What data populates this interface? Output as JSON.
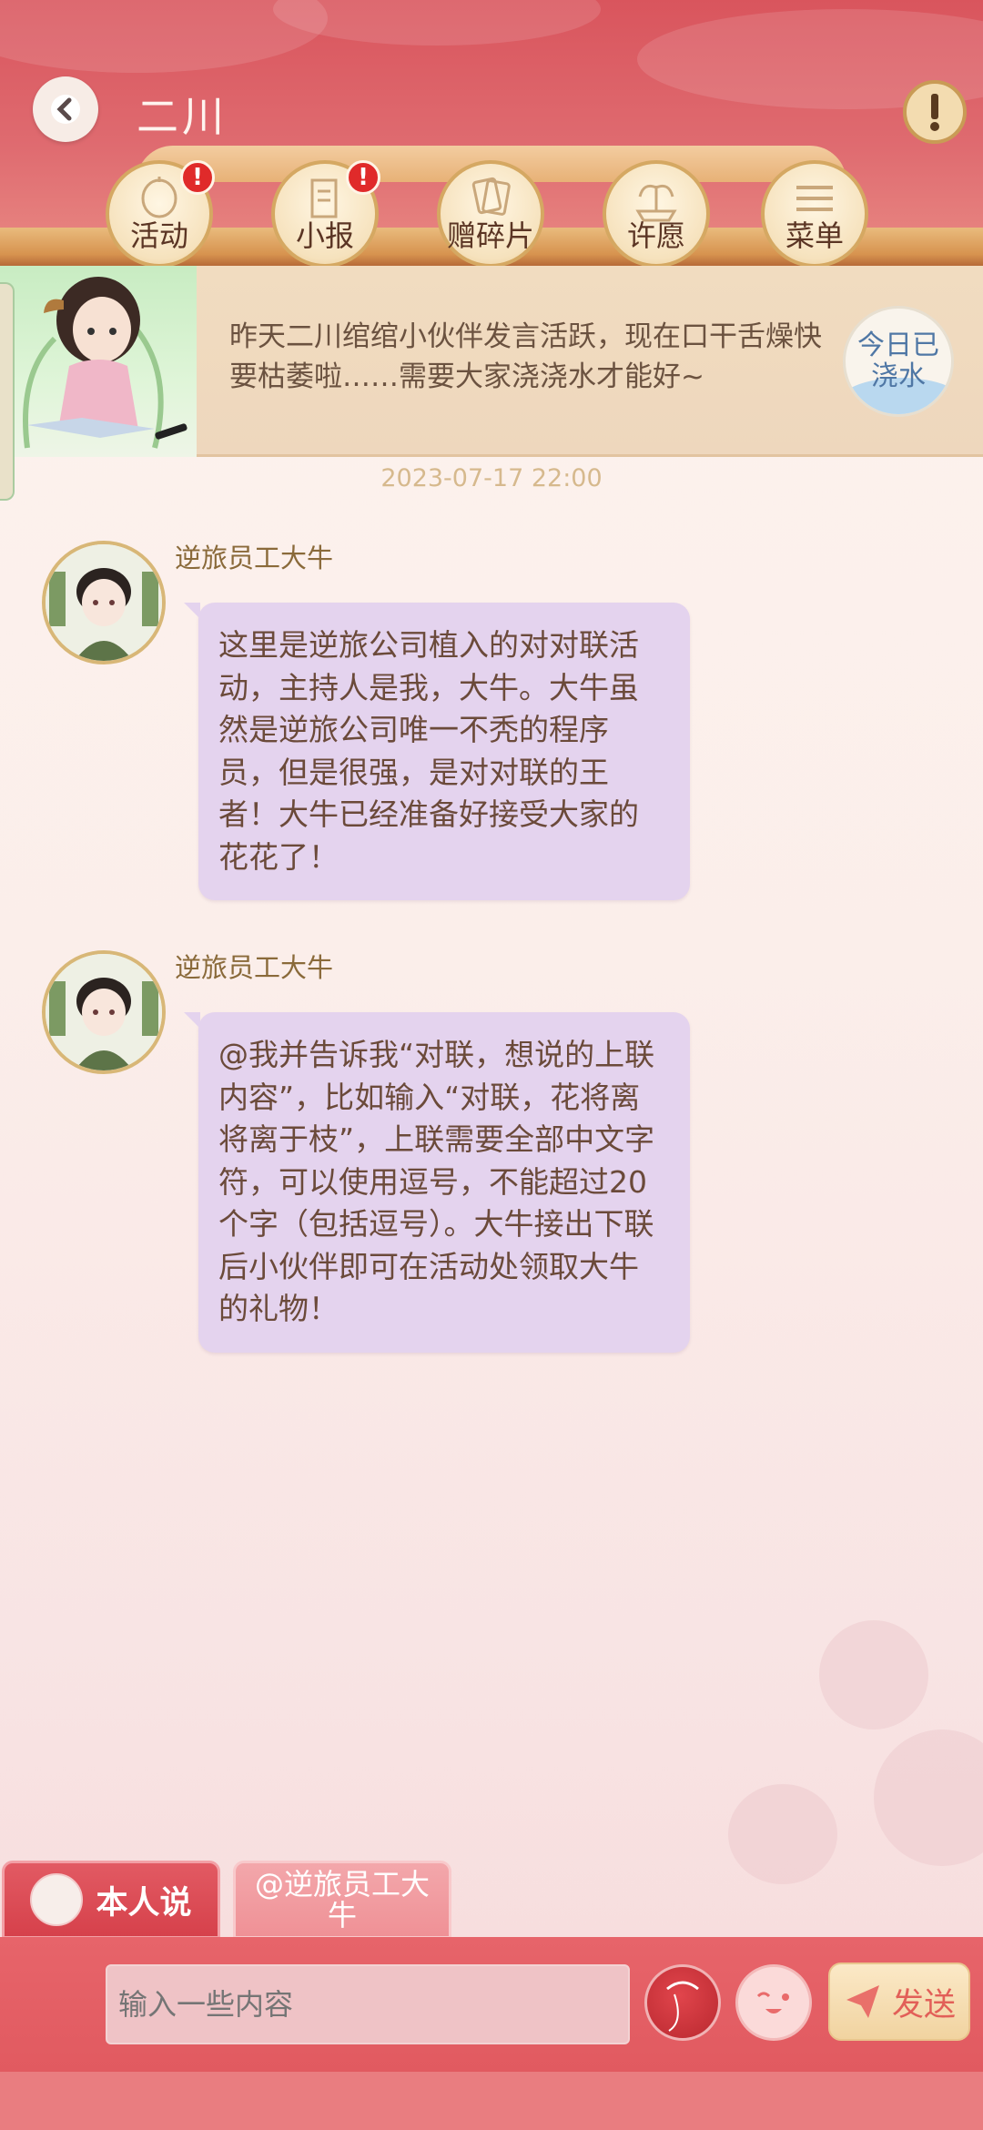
{
  "header": {
    "title": "二川",
    "nav": [
      {
        "label": "活动",
        "badge": "!"
      },
      {
        "label": "小报",
        "badge": "!"
      },
      {
        "label": "赠碎片"
      },
      {
        "label": "许愿"
      },
      {
        "label": "菜单"
      }
    ]
  },
  "banner": {
    "text": "昨天二川绾绾小伙伴发言活跃，现在口干舌燥快要枯萎啦……需要大家浇浇水才能好~",
    "water_button": "今日已浇水"
  },
  "timestamp": "2023-07-17 22:00",
  "messages": [
    {
      "sender": "逆旅员工大牛",
      "text": "这里是逆旅公司植入的对对联活动，主持人是我，大牛。大牛虽然是逆旅公司唯一不秃的程序员，但是很强，是对对联的王者！大牛已经准备好接受大家的花花了！"
    },
    {
      "sender": "逆旅员工大牛",
      "text": "@我并告诉我“对联，想说的上联内容”，比如输入“对联，花将离将离于枝”，上联需要全部中文字符，可以使用逗号，不能超过20个字（包括逗号）。大牛接出下联后小伙伴即可在活动处领取大牛的礼物！"
    }
  ],
  "bottom": {
    "mode_self": "本人说",
    "mode_at": "@逆旅员工大牛",
    "input_placeholder": "输入一些内容",
    "send_label": "发送"
  },
  "colors": {
    "header_red": "#d9555d",
    "bubble_purple": "#e4d3ee",
    "badge_red": "#e02a2a",
    "send_text": "#e25f58"
  }
}
